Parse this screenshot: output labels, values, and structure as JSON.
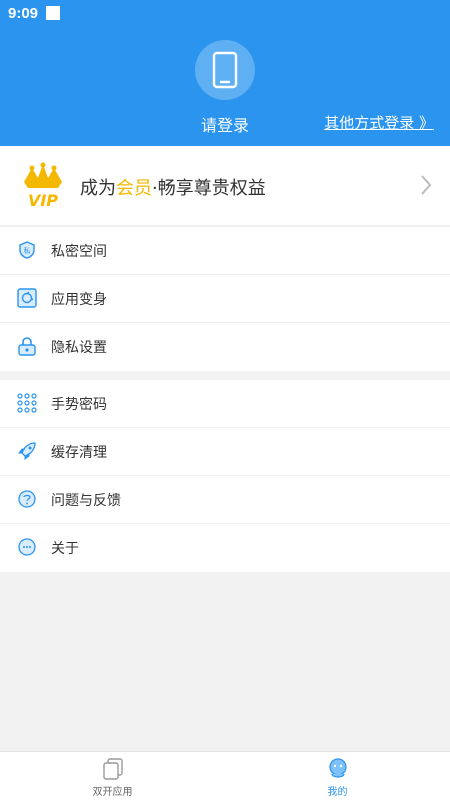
{
  "status_bar": {
    "time": "9:09"
  },
  "header": {
    "login_label": "请登录",
    "other_login": "其他方式登录 》"
  },
  "vip": {
    "logo_text": "VIP",
    "text_before": "成为",
    "text_highlight": "会员",
    "text_after": "·畅享尊贵权益"
  },
  "menu_group_1": [
    {
      "label": "私密空间",
      "icon": "shield-icon"
    },
    {
      "label": "应用变身",
      "icon": "transform-icon"
    },
    {
      "label": "隐私设置",
      "icon": "lock-icon"
    }
  ],
  "menu_group_2": [
    {
      "label": "手势密码",
      "icon": "gesture-pattern-icon"
    },
    {
      "label": "缓存清理",
      "icon": "rocket-icon"
    },
    {
      "label": "问题与反馈",
      "icon": "feedback-icon"
    },
    {
      "label": "关于",
      "icon": "info-icon"
    }
  ],
  "tabbar": {
    "tabs": [
      {
        "label": "双开应用",
        "active": false
      },
      {
        "label": "我的",
        "active": true
      }
    ]
  },
  "colors": {
    "primary": "#2b94ef",
    "vip_gold": "#f5b800",
    "background": "#f2f2f2"
  }
}
